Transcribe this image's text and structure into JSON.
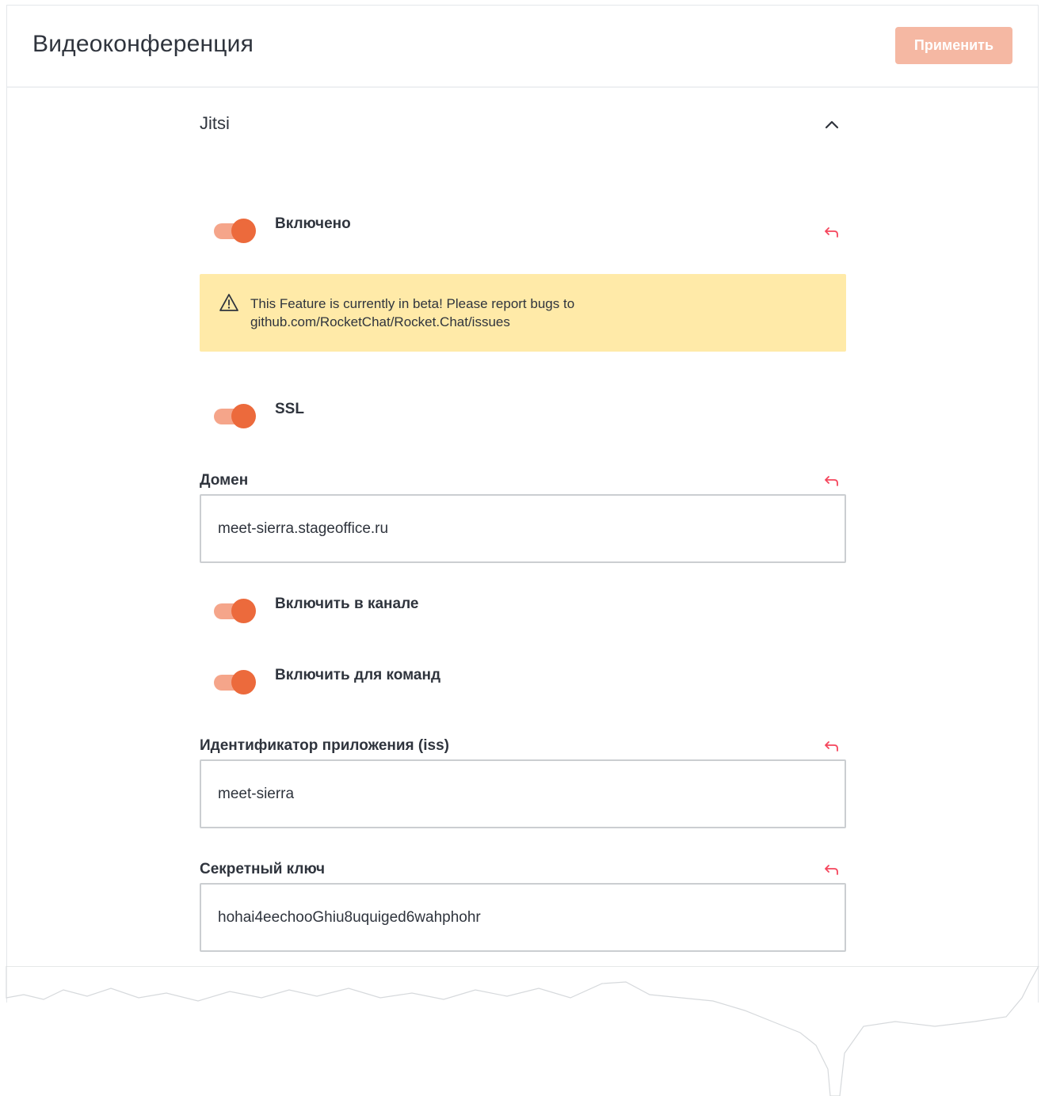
{
  "header": {
    "title": "Видеоконференция",
    "apply_label": "Применить"
  },
  "section": {
    "title": "Jitsi",
    "collapse_icon": "chevron-up-icon"
  },
  "settings": {
    "enabled": {
      "label": "Включено",
      "on": true
    },
    "warning": {
      "icon": "warning-triangle-icon",
      "text_line1": "This Feature is currently in beta! Please report bugs to",
      "text_line2": "github.com/RocketChat/Rocket.Chat/issues",
      "background": "#ffeaa8"
    },
    "ssl": {
      "label": "SSL",
      "on": true
    },
    "domain": {
      "label": "Домен",
      "value": "meet-sierra.stageoffice.ru"
    },
    "enable_in_channels": {
      "label": "Включить в канале",
      "on": true
    },
    "enable_for_teams": {
      "label": "Включить для команд",
      "on": true
    },
    "app_id": {
      "label": "Идентификатор приложения (iss)",
      "value": "meet-sierra"
    },
    "secret": {
      "label": "Секретный ключ",
      "value": "hohai4eechooGhiu8uquiged6wahphohr"
    }
  },
  "colors": {
    "accent": "#ec6a3c",
    "toggle_track": "#f5a58a",
    "apply_disabled": "#f5b8a3",
    "reset_icon": "#f5455c"
  },
  "icons": {
    "reset": "undo-arrow-icon"
  }
}
